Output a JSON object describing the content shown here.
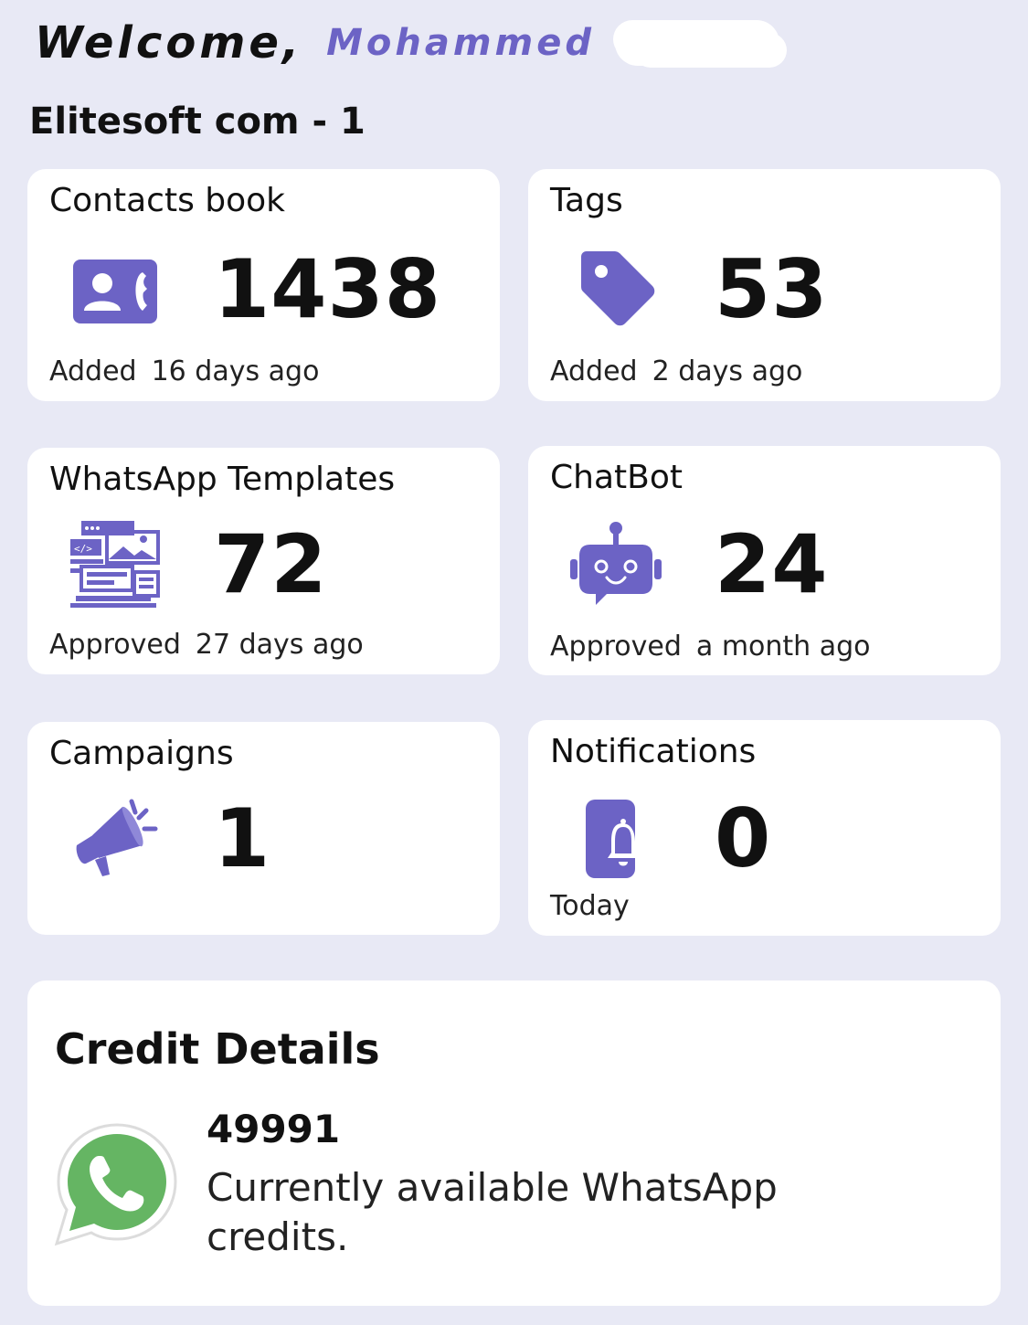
{
  "header": {
    "welcome_label": "Welcome,",
    "user_name": "Mohammed",
    "org_name": "Elitesoft com - 1"
  },
  "cards": {
    "contacts": {
      "title": "Contacts book",
      "value": "1438",
      "footer_label": "Added",
      "footer_time": "16 days ago",
      "icon": "contact-book-icon"
    },
    "tags": {
      "title": "Tags",
      "value": "53",
      "footer_label": "Added",
      "footer_time": "2 days ago",
      "icon": "tag-icon"
    },
    "templates": {
      "title": "WhatsApp Templates",
      "value": "72",
      "footer_label": "Approved",
      "footer_time": "27 days ago",
      "icon": "template-icon"
    },
    "chatbot": {
      "title": "ChatBot",
      "value": "24",
      "footer_label": "Approved",
      "footer_time": "a month ago",
      "icon": "robot-icon"
    },
    "campaigns": {
      "title": "Campaigns",
      "value": "1",
      "icon": "megaphone-icon"
    },
    "notifications": {
      "title": "Notifications",
      "value": "0",
      "footer_time": "Today",
      "icon": "phone-bell-icon"
    }
  },
  "credit": {
    "title": "Credit Details",
    "amount": "49991",
    "description": "Currently available WhatsApp credits.",
    "icon": "whatsapp-icon"
  },
  "colors": {
    "background": "#e8e9f5",
    "accent": "#6c63c5",
    "whatsapp_green": "#65b563"
  }
}
